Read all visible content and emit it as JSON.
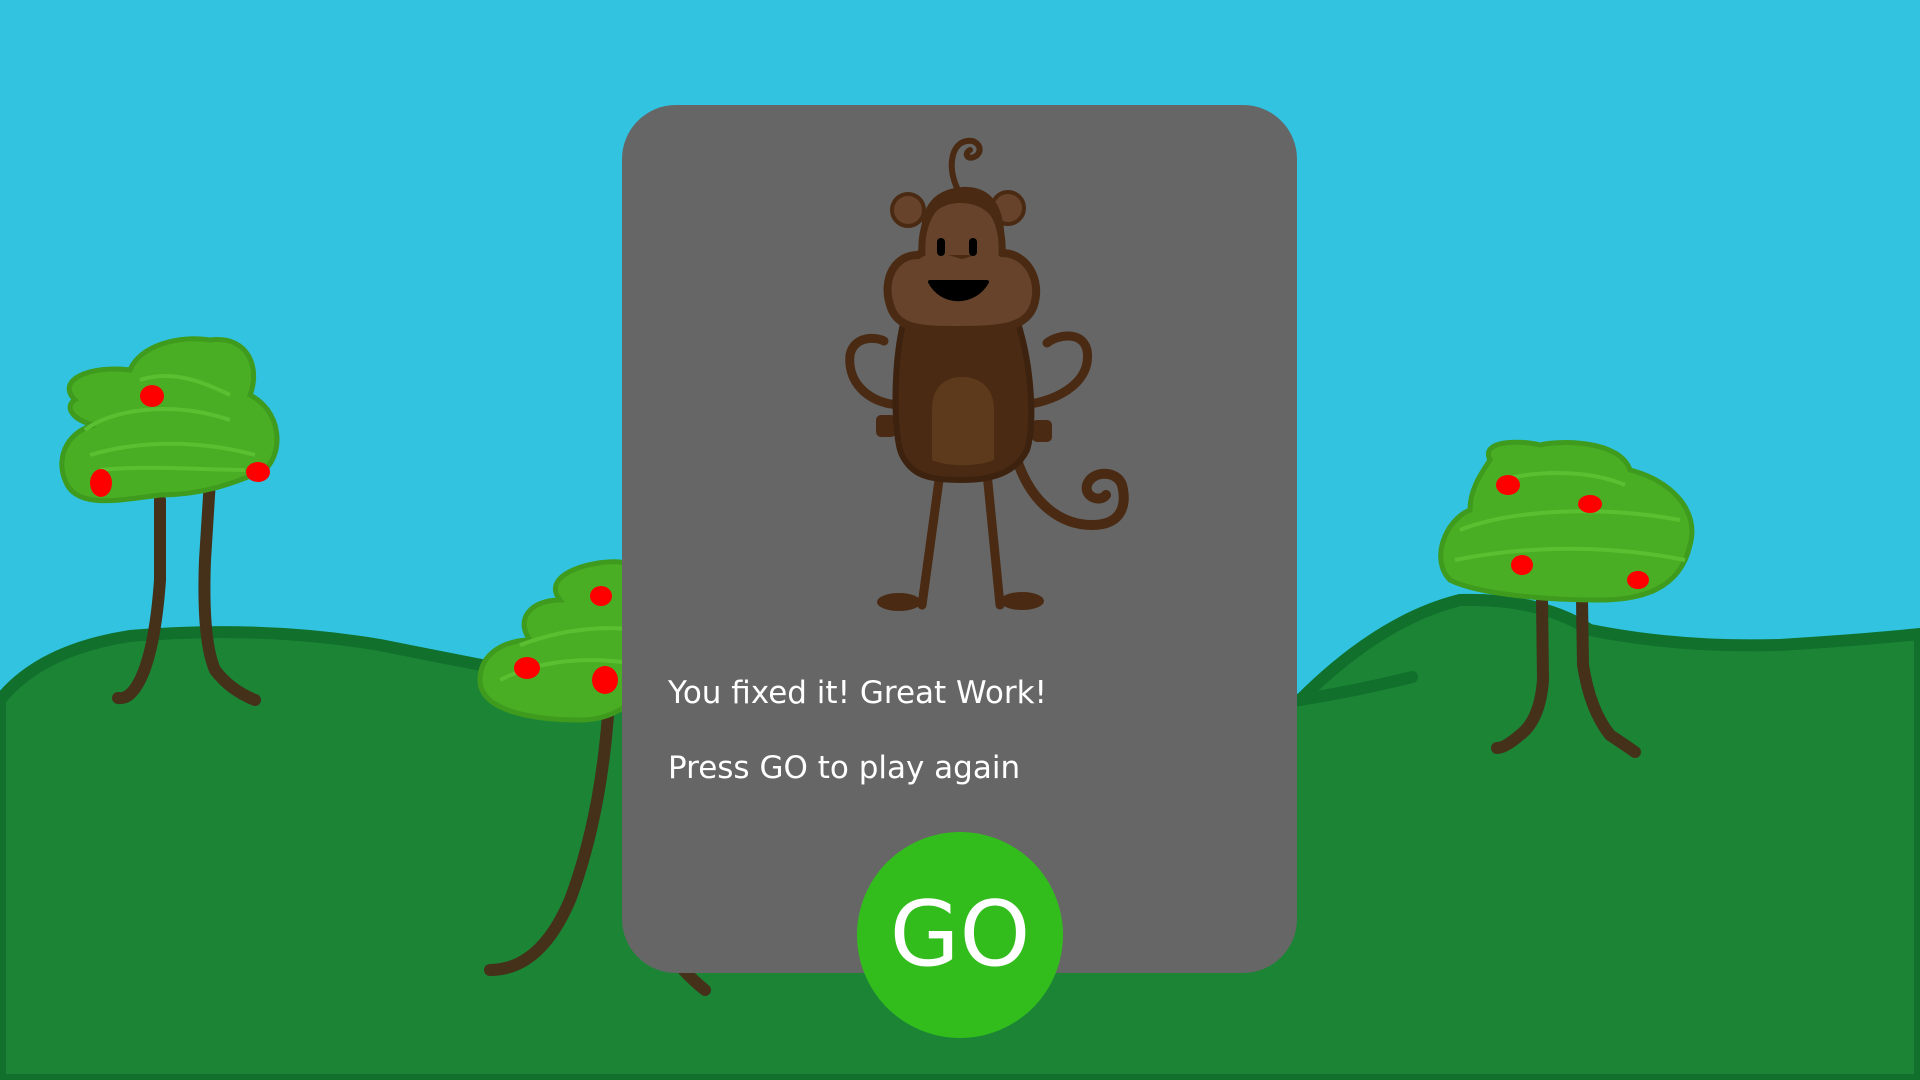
{
  "colors": {
    "sky": "#31c3df",
    "ground": "#1b8535",
    "ground_outline": "#11702b",
    "foliage": "#4aae24",
    "fruit": "#ff0000",
    "trunk": "#45301a",
    "dialog_background": "#666666",
    "go_button": "#33bd1d",
    "text": "#ffffff",
    "monkey_body": "#4a2a12",
    "monkey_face": "#66432a"
  },
  "dialog": {
    "message": "You fixed it! Great Work!",
    "instruction": "Press GO to play again",
    "character": "monkey"
  },
  "go_button": {
    "label": "GO"
  }
}
